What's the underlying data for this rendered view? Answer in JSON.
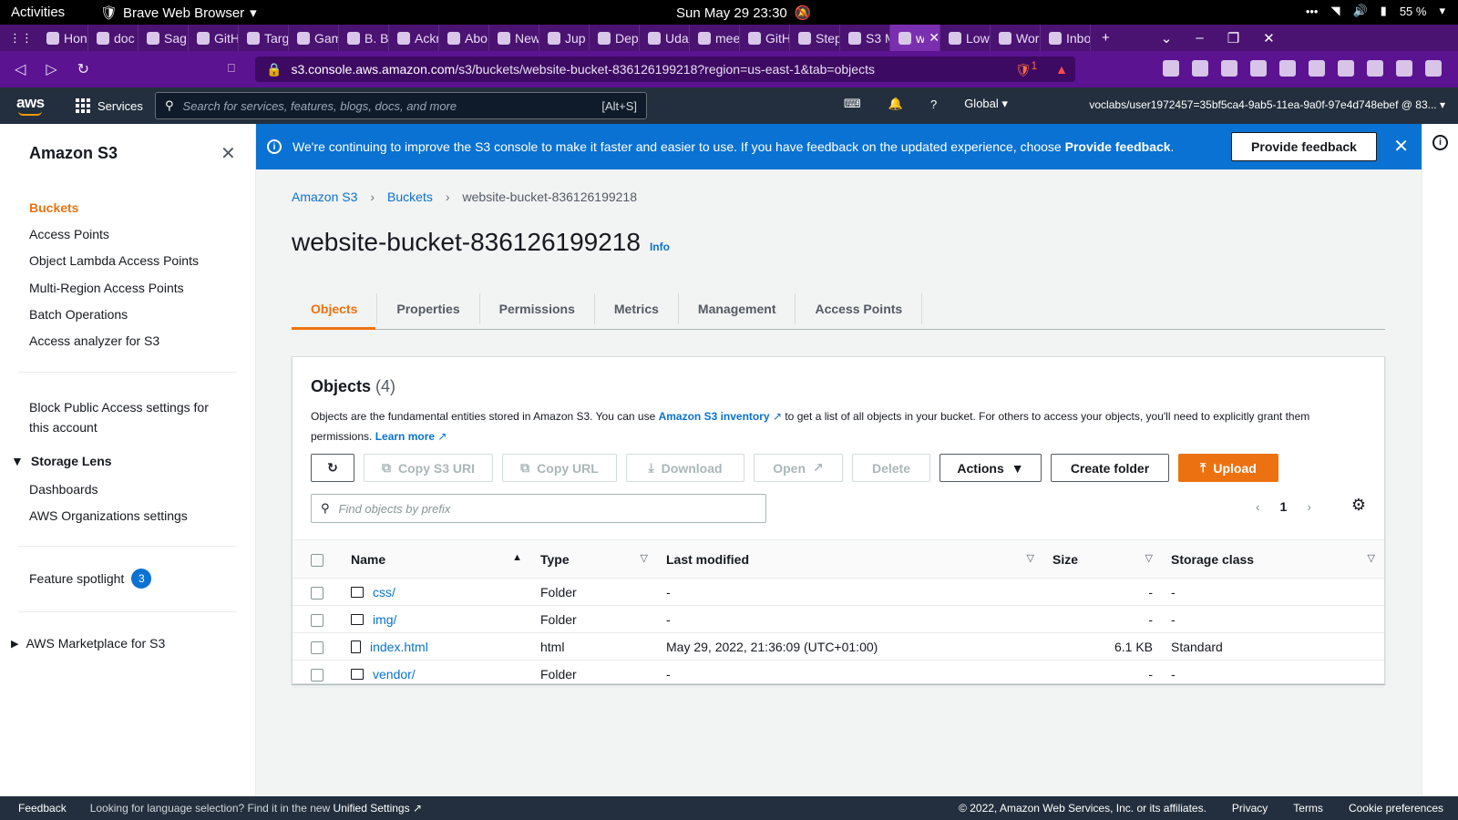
{
  "os": {
    "activities": "Activities",
    "app_name": "Brave Web Browser",
    "datetime": "Sun May 29  23:30",
    "battery": "55 %"
  },
  "browser": {
    "tabs": [
      {
        "label": "Hon"
      },
      {
        "label": "doc"
      },
      {
        "label": "Sag"
      },
      {
        "label": "GitH"
      },
      {
        "label": "Targ"
      },
      {
        "label": "Gam"
      },
      {
        "label": "B. B"
      },
      {
        "label": "Ackr"
      },
      {
        "label": "Abo"
      },
      {
        "label": "New Ta"
      },
      {
        "label": "Jup"
      },
      {
        "label": "Dep"
      },
      {
        "label": "Uda"
      },
      {
        "label": "mee"
      },
      {
        "label": "GitH"
      },
      {
        "label": "Step"
      },
      {
        "label": "S3 M"
      },
      {
        "label": "w",
        "active": true
      },
      {
        "label": "Low"
      },
      {
        "label": "Wor"
      },
      {
        "label": "Inbo"
      }
    ],
    "url_host": "s3.console.aws.amazon.com",
    "url_path": "/s3/buckets/website-bucket-836126199218?region=us-east-1&tab=objects",
    "shield_count": "1"
  },
  "aws": {
    "logo": "aws",
    "services": "Services",
    "search_placeholder": "Search for services, features, blogs, docs, and more",
    "search_shortcut": "[Alt+S]",
    "region": "Global",
    "account": "voclabs/user1972457=35bf5ca4-9ab5-11ea-9a0f-97e4d748ebef @ 83..."
  },
  "sidebar": {
    "title": "Amazon S3",
    "items": [
      {
        "label": "Buckets"
      },
      {
        "label": "Access Points"
      },
      {
        "label": "Object Lambda Access Points"
      },
      {
        "label": "Multi-Region Access Points"
      },
      {
        "label": "Batch Operations"
      },
      {
        "label": "Access analyzer for S3"
      }
    ],
    "block_public_access": "Block Public Access settings for this account",
    "storage_lens": "Storage Lens",
    "storage_lens_items": [
      {
        "label": "Dashboards"
      },
      {
        "label": "AWS Organizations settings"
      }
    ],
    "feature_spotlight": "Feature spotlight",
    "feature_spotlight_count": "3",
    "marketplace": "AWS Marketplace for S3"
  },
  "flash": {
    "message": "We're continuing to improve the S3 console to make it faster and easier to use. If you have feedback on the updated experience, choose ",
    "emphasis": "Provide feedback",
    "period": ".",
    "button": "Provide feedback"
  },
  "breadcrumb": {
    "items": [
      "Amazon S3",
      "Buckets"
    ],
    "current": "website-bucket-836126199218"
  },
  "bucket": {
    "name": "website-bucket-836126199218",
    "info": "Info"
  },
  "tabs": [
    {
      "label": "Objects"
    },
    {
      "label": "Properties"
    },
    {
      "label": "Permissions"
    },
    {
      "label": "Metrics"
    },
    {
      "label": "Management"
    },
    {
      "label": "Access Points"
    }
  ],
  "objects": {
    "heading": "Objects",
    "count": "(4)",
    "desc_1": "Objects are the fundamental entities stored in Amazon S3. You can use ",
    "desc_link": "Amazon S3 inventory",
    "desc_2": " to get a list of all objects in your bucket. For others to access your objects, you'll need to explicitly grant them permissions. ",
    "learn_more": "Learn more",
    "buttons": {
      "copy_uri": "Copy S3 URI",
      "copy_url": "Copy URL",
      "download": "Download",
      "open": "Open",
      "delete": "Delete",
      "actions": "Actions",
      "create_folder": "Create folder",
      "upload": "Upload"
    },
    "find_placeholder": "Find objects by prefix",
    "page": "1",
    "columns": {
      "name": "Name",
      "type": "Type",
      "last_modified": "Last modified",
      "size": "Size",
      "storage_class": "Storage class"
    },
    "rows": [
      {
        "name": "css/",
        "type": "Folder",
        "last_modified": "-",
        "size": "-",
        "storage_class": "-"
      },
      {
        "name": "img/",
        "type": "Folder",
        "last_modified": "-",
        "size": "-",
        "storage_class": "-"
      },
      {
        "name": "index.html",
        "type": "html",
        "last_modified": "May 29, 2022, 21:36:09 (UTC+01:00)",
        "size": "6.1 KB",
        "storage_class": "Standard"
      },
      {
        "name": "vendor/",
        "type": "Folder",
        "last_modified": "-",
        "size": "-",
        "storage_class": "-"
      }
    ]
  },
  "footer": {
    "feedback": "Feedback",
    "language_note": "Looking for language selection? Find it in the new ",
    "unified_settings": "Unified Settings",
    "copyright": "© 2022, Amazon Web Services, Inc. or its affiliates.",
    "privacy": "Privacy",
    "terms": "Terms",
    "cookies": "Cookie preferences"
  },
  "colors": {
    "accent": "#ec7211",
    "link": "#0972d3",
    "aws_nav": "#232f3e",
    "browser_tabs": "#4a1372"
  }
}
